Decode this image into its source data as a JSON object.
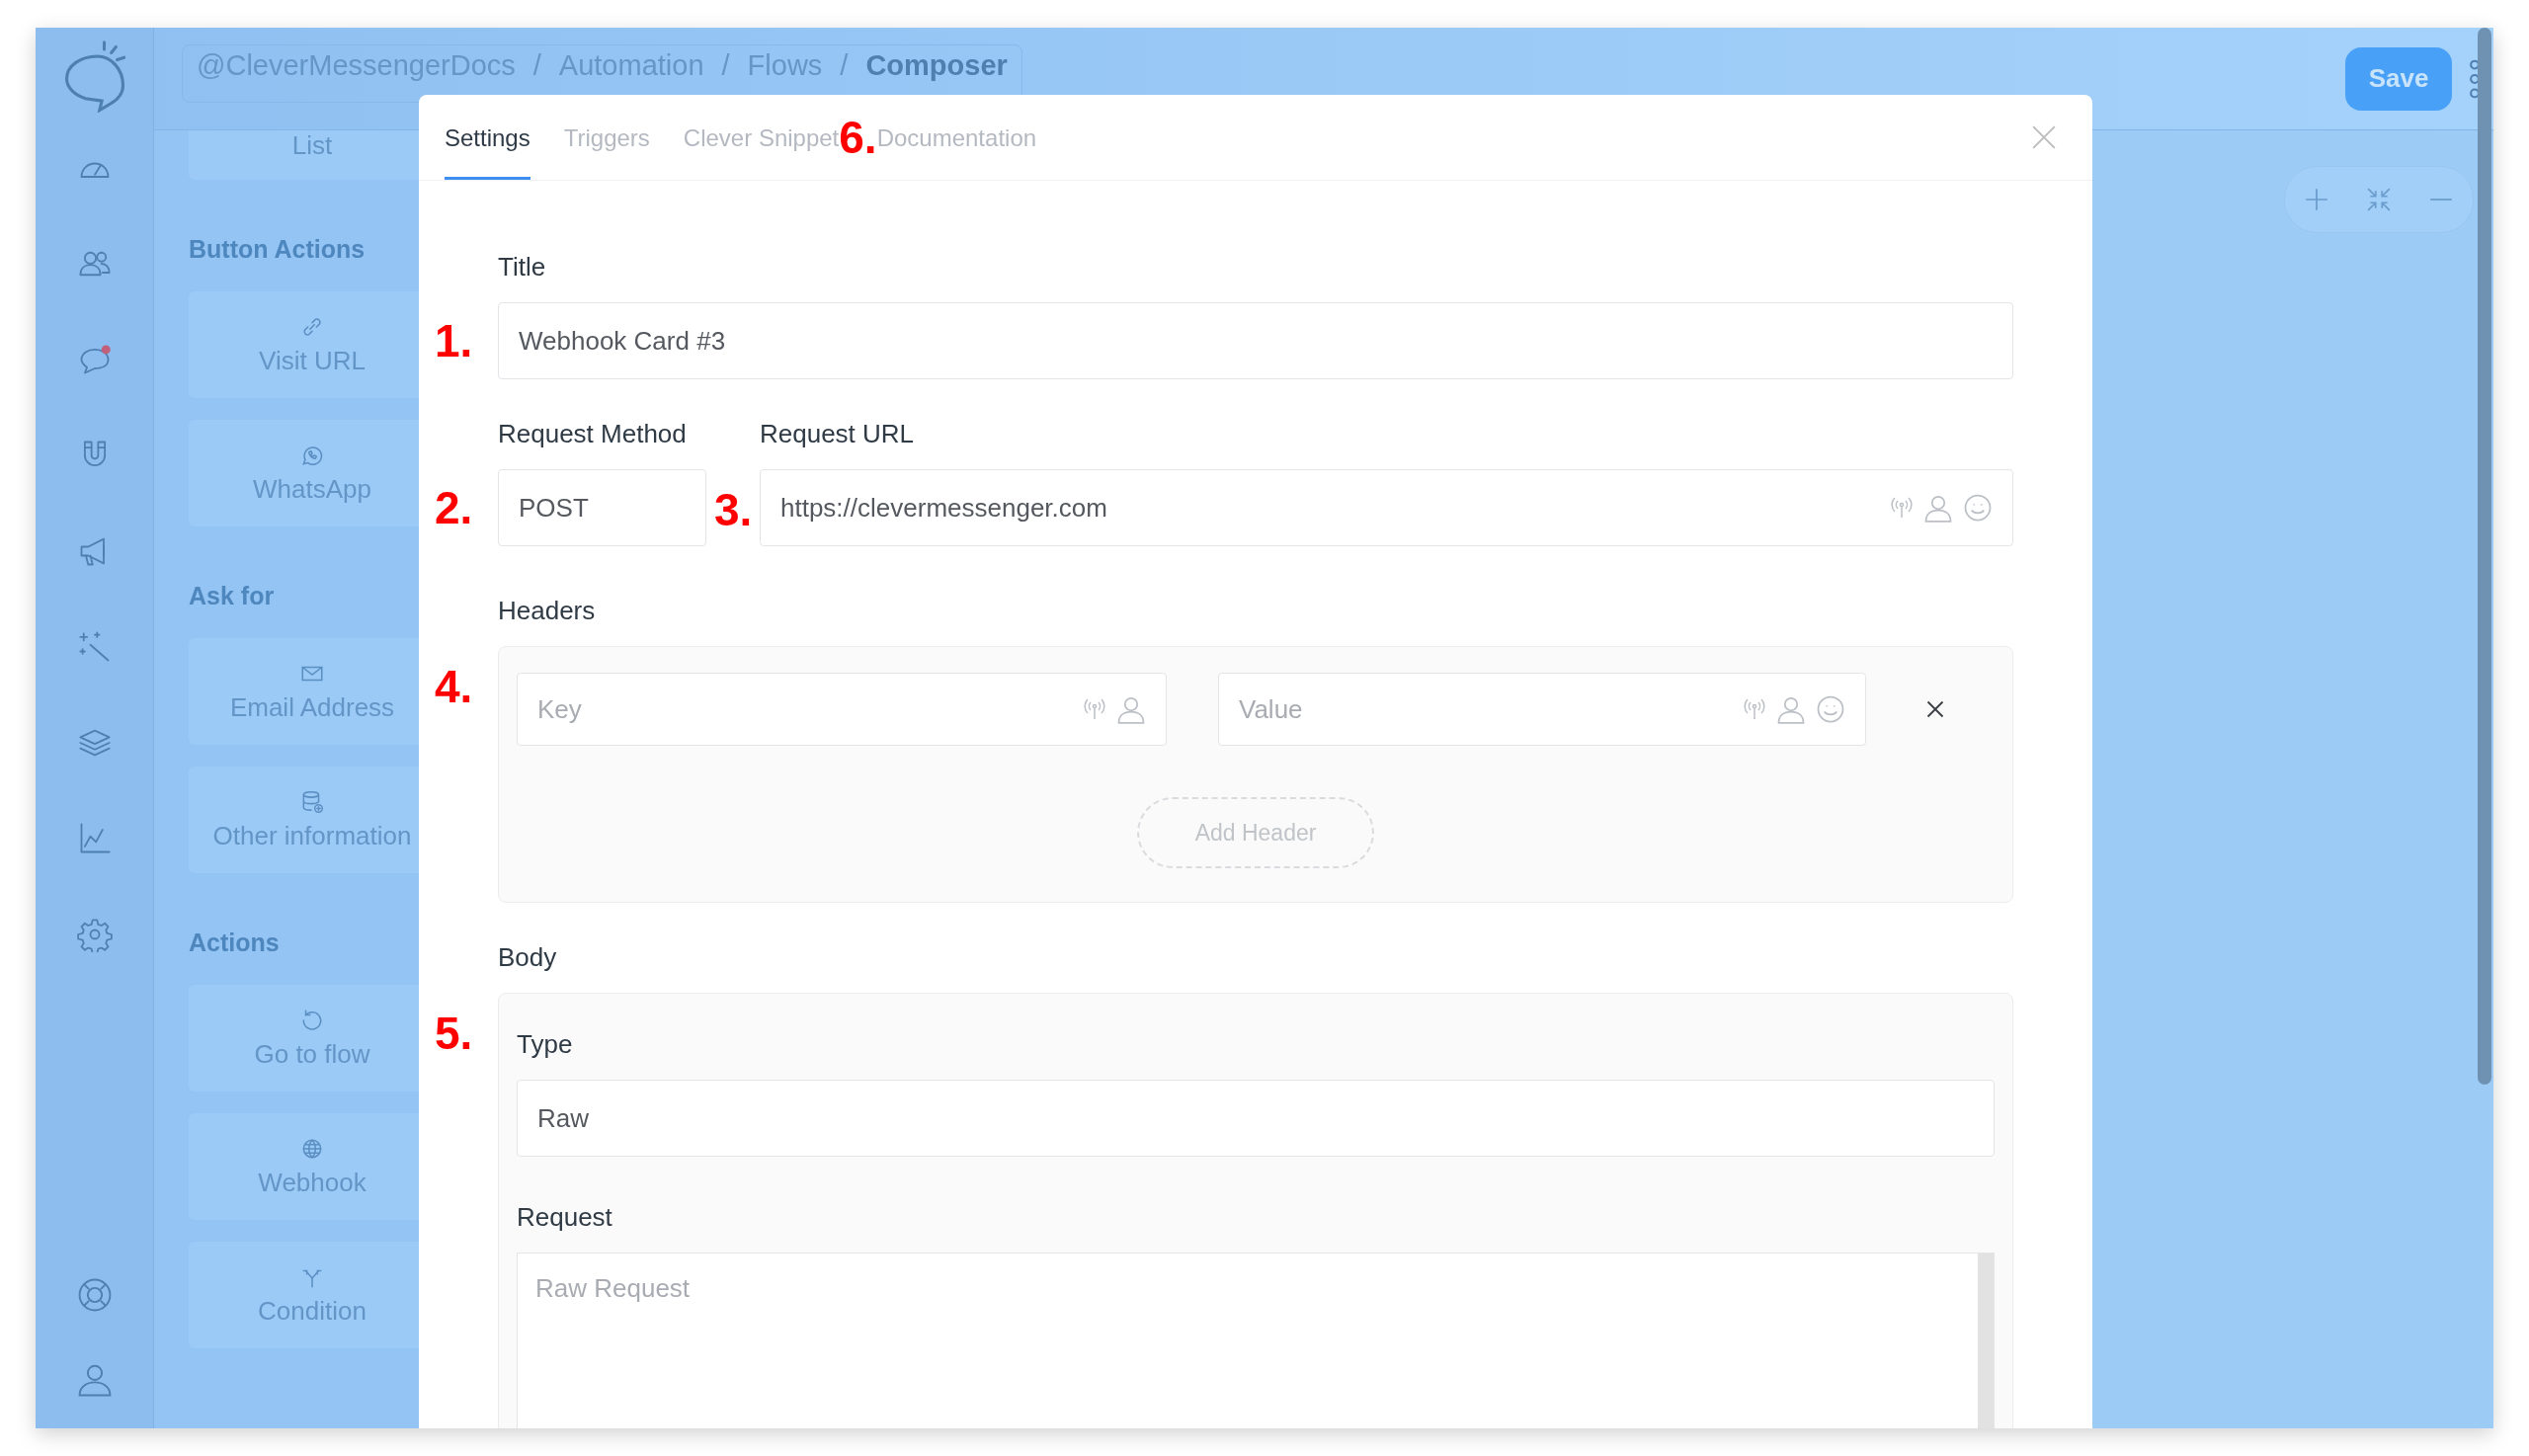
{
  "header": {
    "breadcrumb": [
      {
        "label": "@CleverMessengerDocs",
        "current": false
      },
      {
        "label": "Automation",
        "current": false
      },
      {
        "label": "Flows",
        "current": false
      },
      {
        "label": "Composer",
        "current": true
      }
    ],
    "separator": "/",
    "save_button": "Save"
  },
  "palette": {
    "items": [
      {
        "kind": "card",
        "label": "List"
      },
      {
        "kind": "section",
        "label": "Button Actions"
      },
      {
        "kind": "card",
        "label": "Visit URL"
      },
      {
        "kind": "card",
        "label": "WhatsApp"
      },
      {
        "kind": "section",
        "label": "Ask for"
      },
      {
        "kind": "card",
        "label": "Email Address"
      },
      {
        "kind": "card",
        "label": "Other information"
      },
      {
        "kind": "section",
        "label": "Actions"
      },
      {
        "kind": "card",
        "label": "Go to flow"
      },
      {
        "kind": "card",
        "label": "Webhook"
      },
      {
        "kind": "card",
        "label": "Condition"
      }
    ]
  },
  "modal": {
    "tabs": [
      {
        "label": "Settings",
        "selected": true
      },
      {
        "label": "Triggers",
        "selected": false
      },
      {
        "label": "Clever Snippet",
        "selected": false
      },
      {
        "label": "Documentation",
        "selected": false
      }
    ],
    "tab_marker": "6.",
    "title": {
      "marker": "1.",
      "label": "Title",
      "value": "Webhook Card #3"
    },
    "request_method": {
      "marker": "2.",
      "label": "Request Method",
      "value": "POST"
    },
    "request_url": {
      "marker": "3.",
      "label": "Request URL",
      "value": "https://clevermessenger.com"
    },
    "headers": {
      "marker": "4.",
      "label": "Headers",
      "rows": [
        {
          "key_placeholder": "Key",
          "value_placeholder": "Value"
        }
      ],
      "add_button": "Add Header"
    },
    "body": {
      "marker": "5.",
      "label": "Body",
      "type_label": "Type",
      "type_value": "Raw",
      "request_label": "Request",
      "request_placeholder": "Raw Request"
    }
  }
}
